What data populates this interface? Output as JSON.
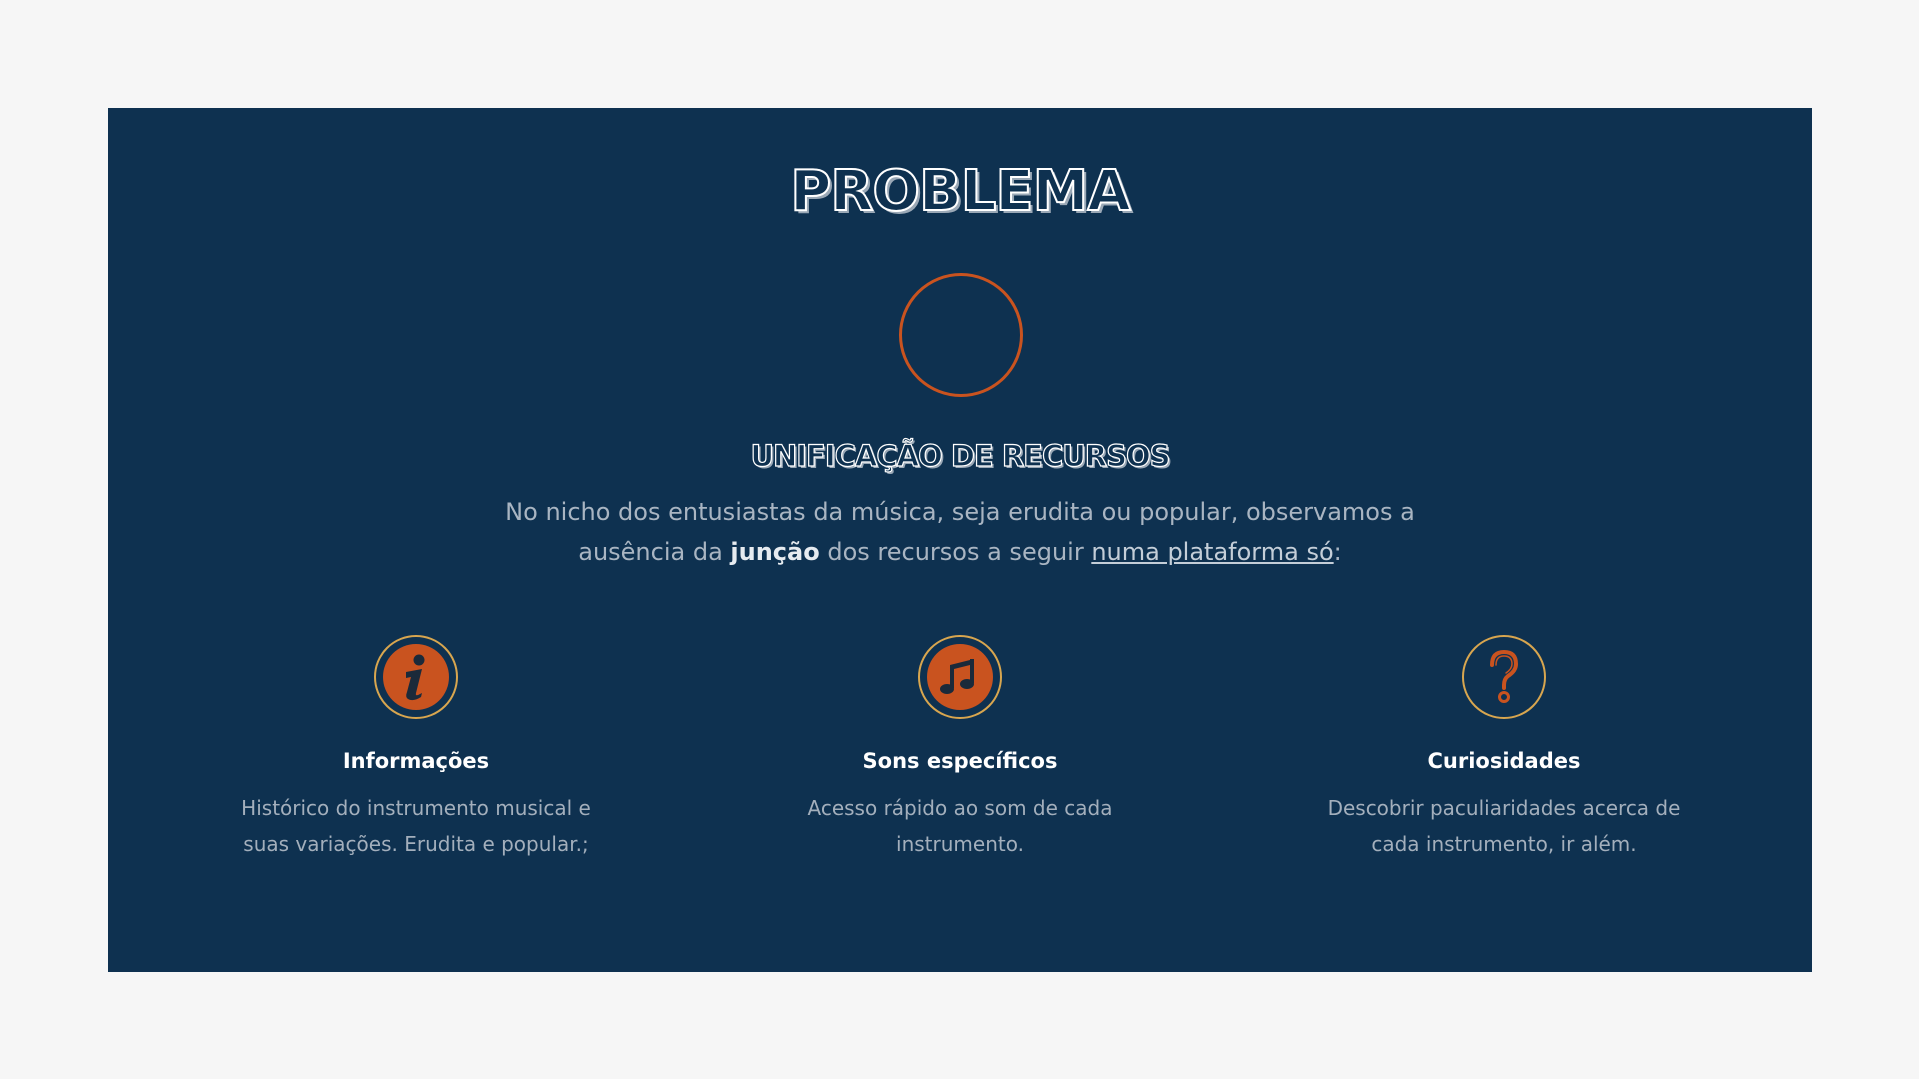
{
  "section": {
    "title": "PROBLEMA",
    "subtitle": "UNIFICAÇÃO DE RECURSOS",
    "intro": {
      "part1": "No nicho dos entusiastas da música, seja erudita ou popular, observamos a ausência da ",
      "bold": "junção",
      "part2": " dos recursos a seguir ",
      "underline": "numa plataforma só",
      "part3": ":"
    }
  },
  "features": [
    {
      "icon": "info-icon",
      "title": "Informações",
      "description": "Histórico do instrumento musical e suas variações. Erudita e popular.;"
    },
    {
      "icon": "music-note-icon",
      "title": "Sons específicos",
      "description": "Acesso rápido ao som de cada instrumento."
    },
    {
      "icon": "question-mark-icon",
      "title": "Curiosidades",
      "description": "Descobrir paculiaridades acerca de cada instrumento, ir além."
    }
  ],
  "colors": {
    "background": "#f6f6f6",
    "panel": "#0e3150",
    "accent": "#c9531f",
    "ring": "#d8a64f"
  }
}
